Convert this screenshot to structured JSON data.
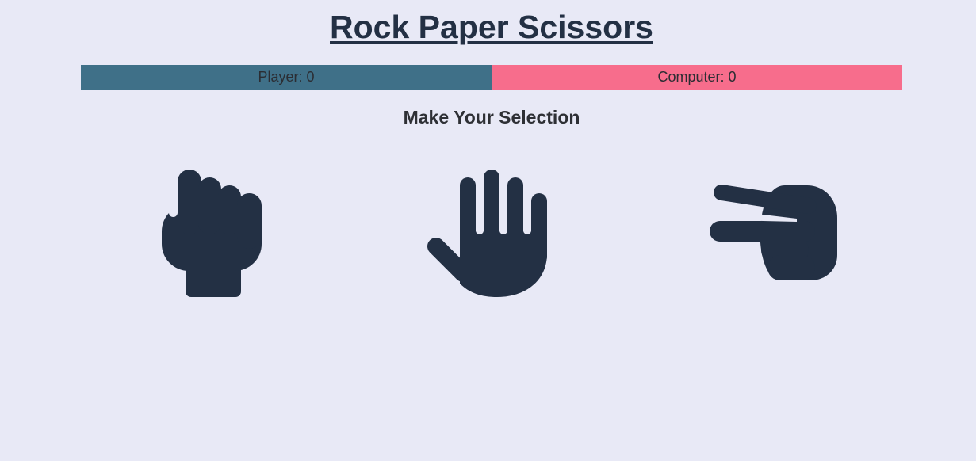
{
  "title": "Rock Paper Scissors",
  "scoreboard": {
    "player": "Player: 0",
    "computer": "Computer: 0"
  },
  "subtitle": "Make Your Selection",
  "choices": [
    {
      "id": "rock",
      "icon": "fist-icon"
    },
    {
      "id": "paper",
      "icon": "open-hand-icon"
    },
    {
      "id": "scissors",
      "icon": "scissors-hand-icon"
    }
  ],
  "colors": {
    "background": "#e8e9f6",
    "player_bar": "#3f7088",
    "computer_bar": "#f76d8c",
    "icon": "#233044"
  }
}
